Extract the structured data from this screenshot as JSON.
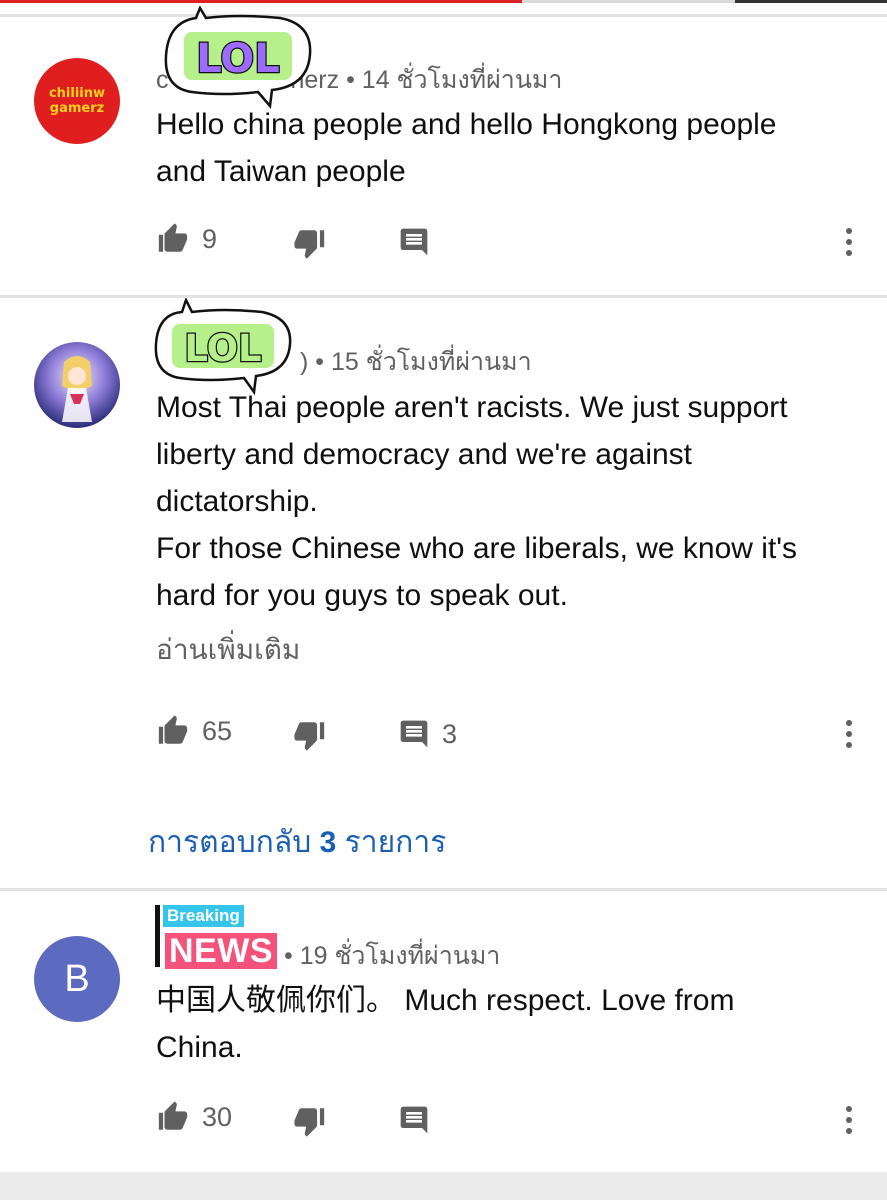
{
  "comments": [
    {
      "avatar_text_line1": "chiliinw",
      "avatar_text_line2": "gamerz",
      "author_visible": "c",
      "author_visible_end": "nerz",
      "time": "• 14 ชั่วโมงที่ผ่านมา",
      "text": [
        "Hello china people and hello Hongkong people",
        "and Taiwan people"
      ],
      "likes": "9",
      "sticker": "LOL"
    },
    {
      "author_visible_end": ")",
      "time": "• 15 ชั่วโมงที่ผ่านมา",
      "text": [
        "Most Thai people aren't racists. We just support",
        "liberty and democracy and we're against",
        "dictatorship.",
        "For those Chinese who are liberals, we know it's",
        "hard for you guys to speak out."
      ],
      "read_more": "อ่านเพิ่มเติม",
      "likes": "65",
      "reply_count": "3",
      "sticker": "LOL",
      "replies_link": {
        "prefix": "การตอบกลับ",
        "count": "3",
        "suffix": "รายการ"
      }
    },
    {
      "avatar_letter": "B",
      "time": "• 19 ชั่วโมงที่ผ่านมา",
      "text": [
        "中国人敬佩你们。 Much respect. Love from",
        "China."
      ],
      "likes": "30",
      "sticker_top": "Breaking",
      "sticker_main": "NEWS"
    }
  ],
  "icons": {
    "like": "thumb-up-icon",
    "dislike": "thumb-down-icon",
    "reply": "comment-icon",
    "more": "more-vert-icon"
  },
  "colors": {
    "text": "#0f0f0f",
    "meta": "#606060",
    "link": "#1a5fb4",
    "avatar_red": "#e01e1e",
    "avatar_b": "#5c6bc0",
    "sticker_green": "#b6f08a",
    "sticker_purple": "#9d6bff"
  }
}
